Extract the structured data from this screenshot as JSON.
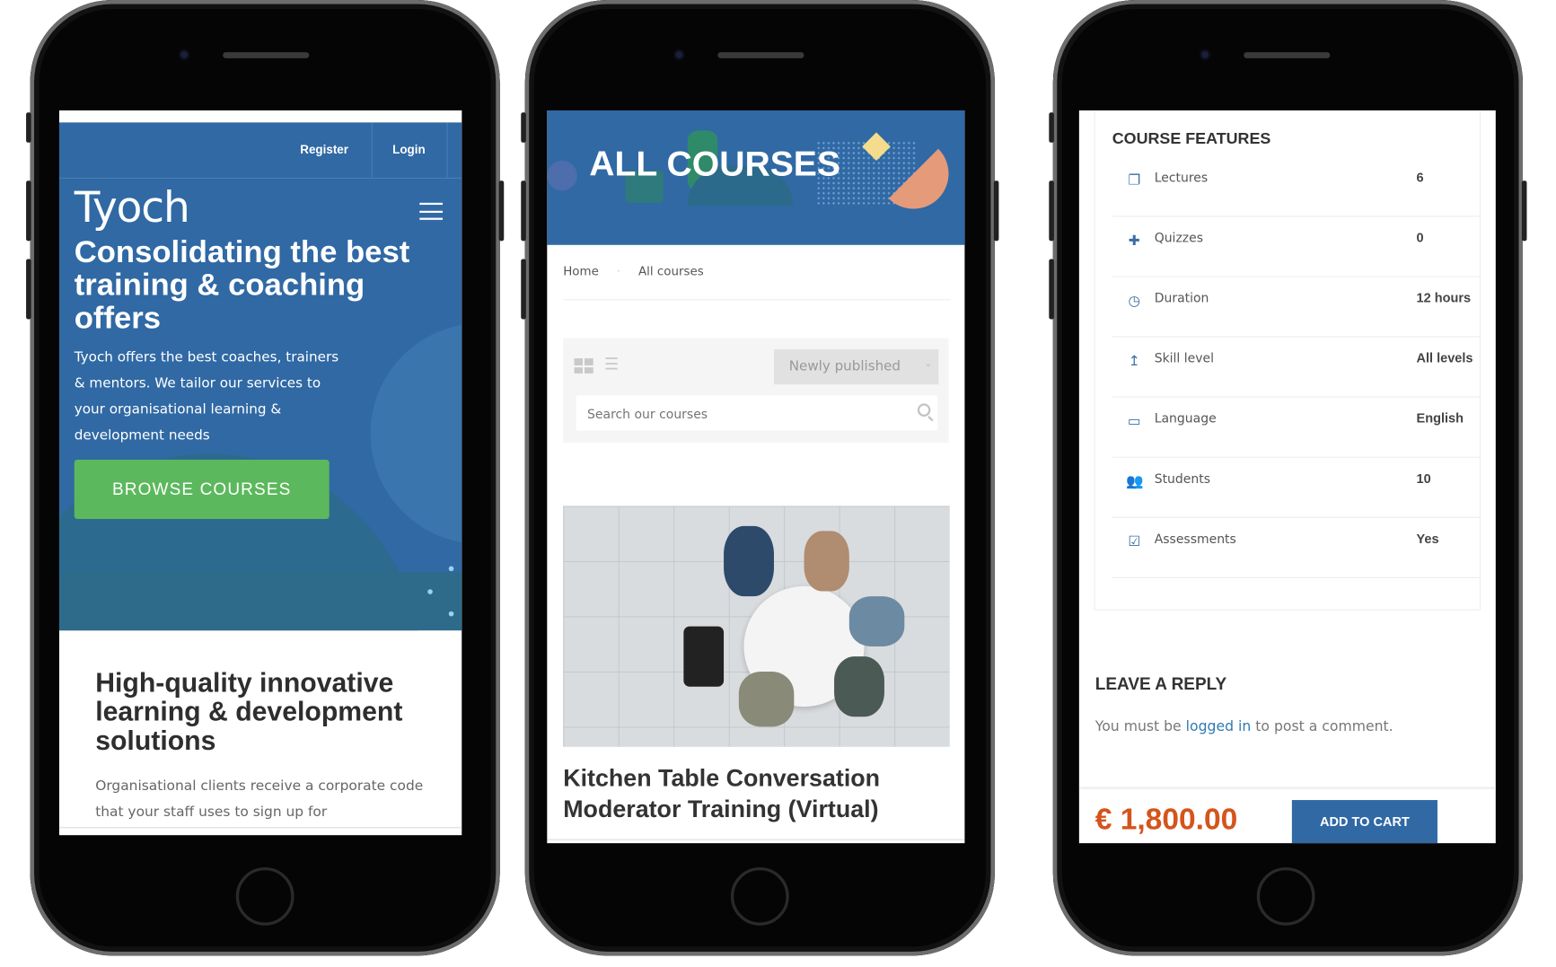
{
  "colors": {
    "brand_blue": "#3069a4",
    "green": "#5cb85c",
    "price_orange": "#d5541c",
    "link_blue": "#2f7bb3"
  },
  "phone1": {
    "register": "Register",
    "login": "Login",
    "logo": "Tyoch",
    "menu_icon": "hamburger-icon",
    "hero_title": "Consolidating the best training & coaching offers",
    "hero_text": "Tyoch offers the best coaches, trainers & mentors. We tailor our services to your organisational learning & development needs",
    "browse_button": "BROWSE COURSES",
    "section_title": "High-quality innovative learning & development solutions",
    "section_text": "Organisational clients receive a corporate code that your staff uses to sign up for"
  },
  "phone2": {
    "banner_title": "ALL COURSES",
    "breadcrumb": [
      "Home",
      "All courses"
    ],
    "sort_select": "Newly published",
    "search_placeholder": "Search our courses",
    "course_title": "Kitchen Table Conversation Moderator Training (Virtual)"
  },
  "phone3": {
    "features_title": "COURSE FEATURES",
    "features": [
      {
        "icon": "copy-icon",
        "label": "Lectures",
        "value": "6"
      },
      {
        "icon": "puzzle-icon",
        "label": "Quizzes",
        "value": "0"
      },
      {
        "icon": "clock-icon",
        "label": "Duration",
        "value": "12 hours"
      },
      {
        "icon": "level-up-icon",
        "label": "Skill level",
        "value": "All levels"
      },
      {
        "icon": "language-icon",
        "label": "Language",
        "value": "English"
      },
      {
        "icon": "users-icon",
        "label": "Students",
        "value": "10"
      },
      {
        "icon": "check-square-icon",
        "label": "Assessments",
        "value": "Yes"
      }
    ],
    "reply_title": "LEAVE A REPLY",
    "reply_pre": "You must be ",
    "reply_link": "logged in",
    "reply_post": " to post a comment.",
    "price": "€ 1,800.00",
    "add_to_cart": "ADD TO CART"
  }
}
